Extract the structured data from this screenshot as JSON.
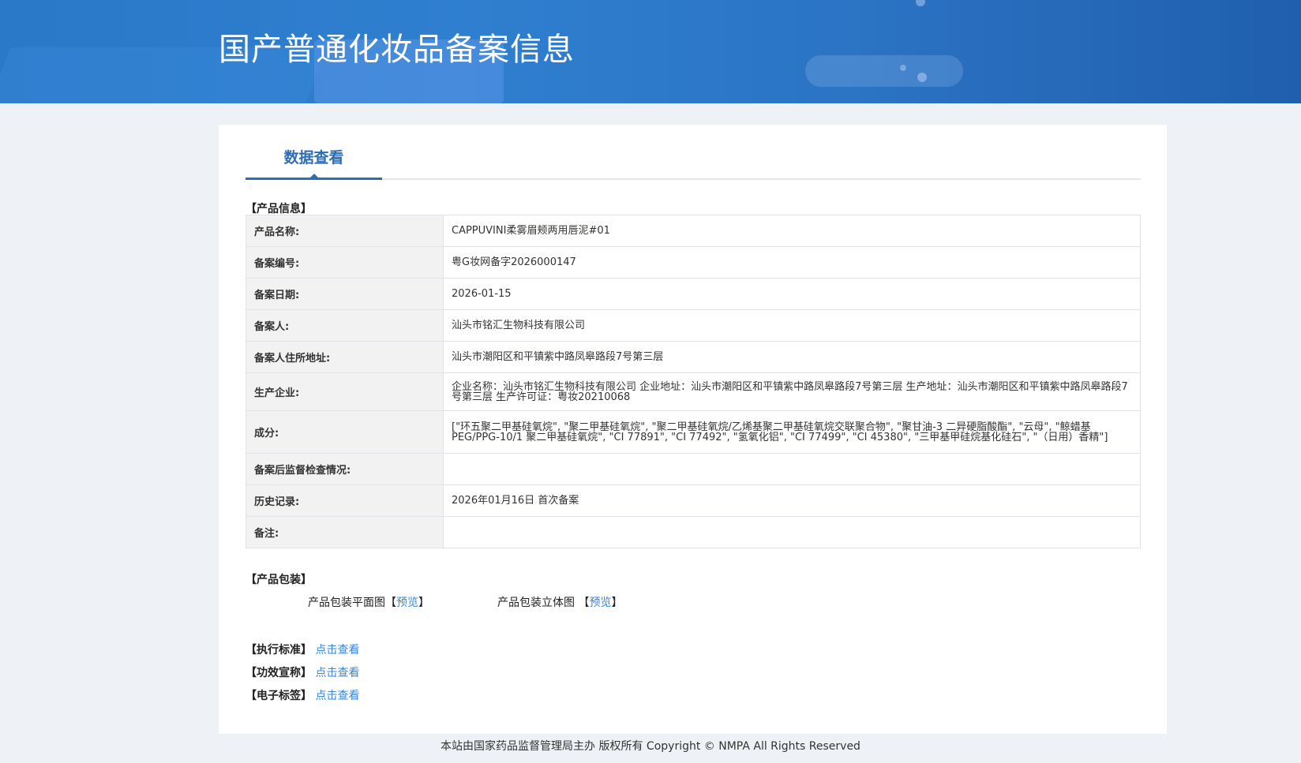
{
  "header": {
    "title": "国产普通化妆品备案信息"
  },
  "tab": {
    "label": "数据查看"
  },
  "sections": {
    "product_info": "【产品信息】",
    "packaging": "【产品包装】"
  },
  "product_info": [
    {
      "key": "产品名称:",
      "value": "CAPPUVINI柔雾眉颊两用唇泥#01"
    },
    {
      "key": "备案编号:",
      "value": "粤G妆网备字2026000147"
    },
    {
      "key": "备案日期:",
      "value": "2026-01-15"
    },
    {
      "key": "备案人:",
      "value": "汕头市铭汇生物科技有限公司"
    },
    {
      "key": "备案人住所地址:",
      "value": "汕头市潮阳区和平镇紫中路凤皋路段7号第三层"
    },
    {
      "key": "生产企业:",
      "value": "企业名称：汕头市铭汇生物科技有限公司 企业地址：汕头市潮阳区和平镇紫中路凤皋路段7号第三层 生产地址：汕头市潮阳区和平镇紫中路凤皋路段7号第三层 生产许可证：粤妆20210068"
    },
    {
      "key": "成分:",
      "value": "[\"环五聚二甲基硅氧烷\", \"聚二甲基硅氧烷\", \"聚二甲基硅氧烷/乙烯基聚二甲基硅氧烷交联聚合物\", \"聚甘油-3 二异硬脂酸酯\", \"云母\", \"鲸蜡基 PEG/PPG-10/1 聚二甲基硅氧烷\", \"CI 77891\", \"CI 77492\", \"氢氧化铝\", \"CI 77499\", \"CI 45380\", \"三甲基甲硅烷基化硅石\", \"（日用）香精\"]"
    },
    {
      "key": "备案后监督检查情况:",
      "value": ""
    },
    {
      "key": "历史记录:",
      "value": "2026年01月16日 首次备案"
    },
    {
      "key": "备注:",
      "value": ""
    }
  ],
  "packaging": {
    "flat_label": "产品包装平面图",
    "flat_bracket_open": "【",
    "flat_link": "预览",
    "flat_bracket_close": "】",
    "solid_label": "产品包装立体图 ",
    "solid_bracket_open": "【",
    "solid_link": "预览",
    "solid_bracket_close": "】"
  },
  "extras": [
    {
      "label": "【执行标准】",
      "link": "点击查看"
    },
    {
      "label": "【功效宣称】",
      "link": "点击查看"
    },
    {
      "label": "【电子标签】",
      "link": "点击查看"
    }
  ],
  "footer": {
    "text": "本站由国家药品监督管理局主办 版权所有 Copyright © NMPA All Rights Reserved"
  }
}
